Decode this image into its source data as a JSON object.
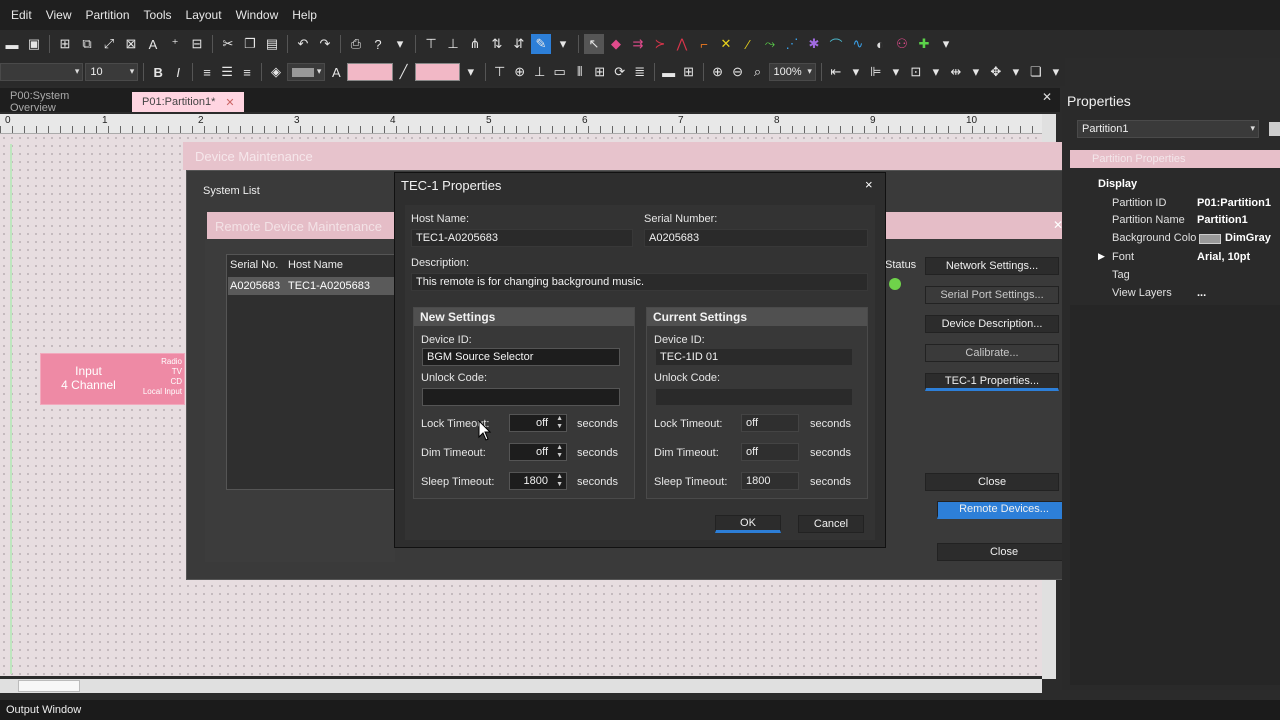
{
  "menu": [
    "Edit",
    "View",
    "Partition",
    "Tools",
    "Layout",
    "Window",
    "Help"
  ],
  "toolbar": {
    "font_size": "10",
    "zoom": "100%"
  },
  "tabs": [
    {
      "label": "P00:System Overview"
    },
    {
      "label": "P01:Partition1*"
    }
  ],
  "ruler_ticks": [
    "0",
    "1",
    "2",
    "3",
    "4",
    "5",
    "6",
    "7",
    "8",
    "9",
    "10"
  ],
  "canvas": {
    "node": {
      "title_line1": "Input",
      "title_line2": "4 Channel",
      "ports": [
        "Radio",
        "TV",
        "CD",
        "Local Input"
      ]
    }
  },
  "properties": {
    "title": "Properties",
    "selector": "Partition1",
    "header": "Partition Properties",
    "section": "Display",
    "rows": [
      {
        "key": "Partition ID",
        "value": "P01:Partition1"
      },
      {
        "key": "Partition Name",
        "value": "Partition1"
      },
      {
        "key": "Background Colo",
        "value": "DimGray"
      },
      {
        "key": "Font",
        "value": "Arial, 10pt"
      },
      {
        "key": "Tag",
        "value": ""
      },
      {
        "key": "View Layers",
        "value": "..."
      }
    ]
  },
  "device_maintenance": {
    "title": "Device Maintenance",
    "system_list_label": "System List",
    "status_label": "Status",
    "right_buttons": [
      {
        "label": "Network Settings..."
      },
      {
        "label": "Serial Port Settings..."
      },
      {
        "label": "Device Description..."
      },
      {
        "label": "Calibrate..."
      },
      {
        "label": "TEC-1 Properties..."
      },
      {
        "label": "Close"
      }
    ],
    "remote_devices_button": "Remote Devices...",
    "close_button": "Close"
  },
  "remote_maintenance": {
    "title": "Remote Device Maintenance",
    "columns": [
      "Serial No.",
      "Host Name"
    ],
    "rows": [
      {
        "serial": "A0205683",
        "host": "TEC1-A0205683"
      }
    ]
  },
  "tec_dialog": {
    "title": "TEC-1 Properties",
    "close_glyph": "×",
    "host_name_label": "Host Name:",
    "host_name": "TEC1-A0205683",
    "serial_label": "Serial Number:",
    "serial": "A0205683",
    "description_label": "Description:",
    "description": "This remote is for changing background music.",
    "new_settings": {
      "title": "New Settings",
      "device_id_label": "Device ID:",
      "device_id": "BGM Source Selector",
      "unlock_label": "Unlock Code:",
      "unlock_code": "",
      "lock_label": "Lock Timeout:",
      "lock": "off",
      "dim_label": "Dim Timeout:",
      "dim": "off",
      "sleep_label": "Sleep Timeout:",
      "sleep": "1800",
      "unit": "seconds"
    },
    "current_settings": {
      "title": "Current Settings",
      "device_id_label": "Device ID:",
      "device_id": "TEC-1ID 01",
      "unlock_label": "Unlock Code:",
      "unlock_code": "",
      "lock_label": "Lock Timeout:",
      "lock": "off",
      "dim_label": "Dim Timeout:",
      "dim": "off",
      "sleep_label": "Sleep Timeout:",
      "sleep": "1800",
      "unit": "seconds"
    },
    "ok_label": "OK",
    "cancel_label": "Cancel"
  },
  "output_window": "Output Window",
  "colors": {
    "accent": "#2d7fd8",
    "canvas_pink": "#ffd5e1",
    "node_pink": "#ee8aa5",
    "status_green": "#6fd34a"
  }
}
